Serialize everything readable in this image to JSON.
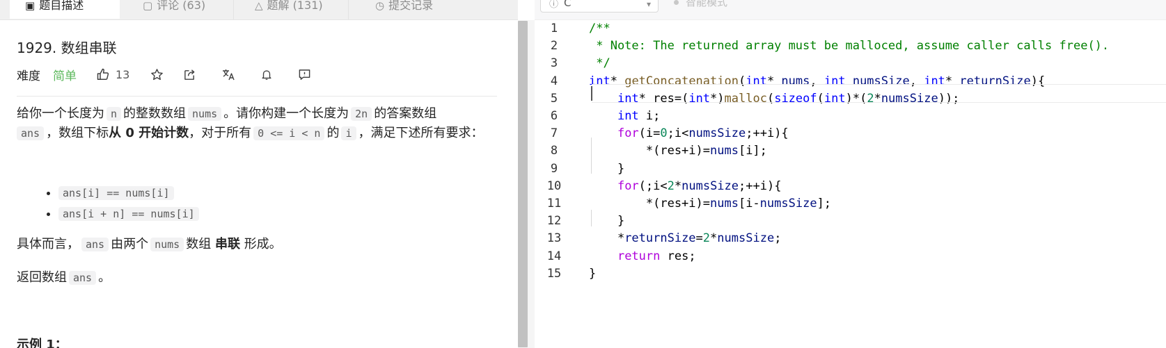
{
  "tabs": [
    {
      "label": "题目描述",
      "icon": "document-icon",
      "active": true
    },
    {
      "label": "评论 (63)",
      "icon": "comment-icon",
      "active": false
    },
    {
      "label": "题解 (131)",
      "icon": "flask-icon",
      "active": false
    },
    {
      "label": "提交记录",
      "icon": "clock-icon",
      "active": false
    }
  ],
  "editor_toolbar": {
    "language": "C",
    "smart_mode": "智能模式"
  },
  "problem": {
    "title": "1929. 数组串联",
    "difficulty_label": "难度",
    "difficulty": "简单",
    "likes": "13",
    "desc_p1_a": "给你一个长度为",
    "desc_p1_code1": "n",
    "desc_p1_b": "的整数数组",
    "desc_p1_code2": "nums",
    "desc_p1_c": "。请你构建一个长度为",
    "desc_p1_code3": "2n",
    "desc_p1_d": "的答案数组",
    "desc_p1_code4": "ans",
    "desc_p1_e": "，数组下标",
    "desc_p1_bold": "从 0 开始计数",
    "desc_p1_f": "，对于所有",
    "desc_p1_code5": "0 <= i < n",
    "desc_p1_g": "的",
    "desc_p1_code6": "i",
    "desc_p1_h": "，满足下述所有要求：",
    "requirements": [
      "ans[i] == nums[i]",
      "ans[i + n] == nums[i]"
    ],
    "desc_p2_a": "具体而言，",
    "desc_p2_code": "ans",
    "desc_p2_b": "由两个",
    "desc_p2_code2": "nums",
    "desc_p2_c": "数组",
    "desc_p2_bold": "串联",
    "desc_p2_d": "形成。",
    "desc_p3_a": "返回数组",
    "desc_p3_code": "ans",
    "desc_p3_b": "。",
    "example_title": "示例 1："
  },
  "code": {
    "line_numbers": [
      "1",
      "2",
      "3",
      "4",
      "5",
      "6",
      "7",
      "8",
      "9",
      "10",
      "11",
      "12",
      "13",
      "14",
      "15"
    ],
    "lines": [
      "/**",
      " * Note: The returned array must be malloced, assume caller calls free().",
      " */",
      "int* getConcatenation(int* nums, int numsSize, int* returnSize){",
      "    int* res=(int*)malloc(sizeof(int)*(2*numsSize));",
      "    int i;",
      "    for(i=0;i<numsSize;++i){",
      "        *(res+i)=nums[i];",
      "    }",
      "    for(;i<2*numsSize;++i){",
      "        *(res+i)=nums[i-numsSize];",
      "    }",
      "    *returnSize=2*numsSize;",
      "    return res;",
      "}"
    ]
  }
}
